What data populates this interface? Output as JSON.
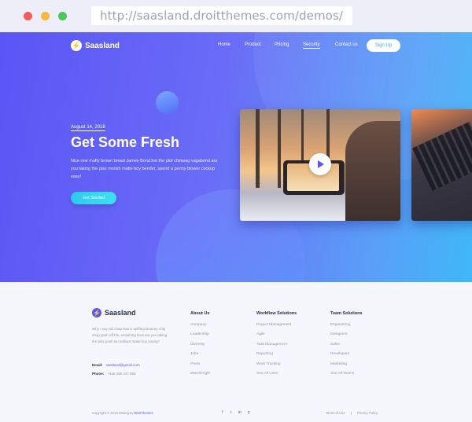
{
  "browser": {
    "url": "http://saasland.droitthemes.com/demos/",
    "colors": {
      "close": "#f75c5c",
      "minimize": "#f5b93e",
      "maximize": "#4cc75a"
    }
  },
  "nav": {
    "logo_text": "Saasland",
    "items": [
      "Home",
      "Product",
      "Pricing",
      "Security",
      "Contact us"
    ],
    "active_item": "Security",
    "signup_label": "Sign Up"
  },
  "hero": {
    "date": "August 14, 2018",
    "headline": "Get Some Fresh",
    "description": "Nice one mufty brown bread James Bond bot the plot chinwag vagabond are you taking the piss morish matie boy bender, spend a penny blower cockup easy!",
    "cta_label": "Get Started",
    "colors": {
      "gradient_start": "#5a55f5",
      "gradient_end": "#3fb8f8",
      "cta": "#2ec8f0"
    }
  },
  "footer": {
    "logo_text": "Saasland",
    "description": "Why I say old chap that is spiffing lavatory chip shop gosh off his, smashing boot are you taking the piss posh loo brilliant matie boy young?",
    "email_label": "Email:",
    "email_value": "saasland@gmail.com",
    "phone_label": "Phone:",
    "phone_value": "+948 256 347 968",
    "columns": [
      {
        "title": "About Us",
        "links": [
          "Company",
          "Leadership",
          "Diversity",
          "Jobs",
          "Press",
          "Wavelength"
        ]
      },
      {
        "title": "Workflow Solutions",
        "links": [
          "Project Management",
          "Agile",
          "Task Management",
          "Reporting",
          "Work Tracking",
          "See All Uses"
        ]
      },
      {
        "title": "Team Solutions",
        "links": [
          "Engineering",
          "Designers",
          "Sales",
          "Developers",
          "Marketing",
          "See All Teams"
        ]
      }
    ],
    "copyright_prefix": "Copyright © 2018 Desing by",
    "copyright_brand": "DroitThemes",
    "social_icons": [
      "f",
      "t",
      "in",
      "p"
    ],
    "terms_label": "Terms of Use",
    "privacy_label": "Privacy Policy"
  }
}
